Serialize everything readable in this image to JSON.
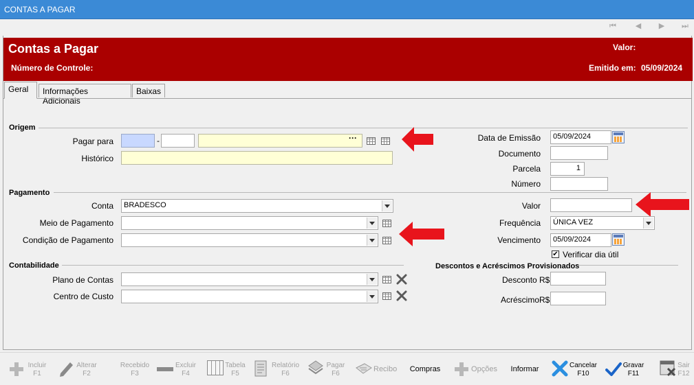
{
  "window": {
    "title": "CONTAS A PAGAR"
  },
  "nav": {
    "first": "⏮",
    "prev": "◀",
    "next": "▶",
    "last": "⏭"
  },
  "header": {
    "title": "Contas a Pagar",
    "valor_label": "Valor:",
    "controle_label": "Número de Controle:",
    "emitido_label": "Emitido em:",
    "emitido_value": "05/09/2024"
  },
  "tabs": [
    "Geral",
    "Informações Adicionais",
    "Baixas"
  ],
  "origem": {
    "section": "Origem",
    "pagar_para_label": "Pagar para",
    "pagar_para_dash": "-",
    "pagar_para_dots": "···",
    "historico_label": "Histórico"
  },
  "right_fields": {
    "data_emissao_label": "Data de Emissão",
    "data_emissao_value": "05/09/2024",
    "documento_label": "Documento",
    "parcela_label": "Parcela",
    "parcela_value": "1",
    "numero_label": "Número",
    "valor_label": "Valor",
    "frequencia_label": "Frequência",
    "frequencia_value": "ÚNICA VEZ",
    "vencimento_label": "Vencimento",
    "vencimento_value": "05/09/2024",
    "verificar_label": "Verificar dia útil",
    "verificar_checked": "✔"
  },
  "pagamento": {
    "section": "Pagamento",
    "conta_label": "Conta",
    "conta_value": "BRADESCO",
    "meio_label": "Meio de Pagamento",
    "condicao_label": "Condição de Pagamento"
  },
  "contabilidade": {
    "section": "Contabilidade",
    "plano_label": "Plano de Contas",
    "centro_label": "Centro de Custo"
  },
  "descontos": {
    "section": "Descontos e Acréscimos  Provisionados",
    "desconto_label": "Desconto",
    "acrescimo_label": "Acréscimo",
    "currency": "R$"
  },
  "toolbar": [
    {
      "name": "incluir",
      "label": "Incluir",
      "key": "F1",
      "enabled": false
    },
    {
      "name": "alterar",
      "label": "Alterar",
      "key": "F2",
      "enabled": false
    },
    {
      "name": "recebido",
      "label": "Recebido",
      "key": "F3",
      "enabled": false
    },
    {
      "name": "excluir",
      "label": "Excluir",
      "key": "F4",
      "enabled": false
    },
    {
      "name": "tabela",
      "label": "Tabela",
      "key": "F5",
      "enabled": false
    },
    {
      "name": "relatorio",
      "label": "Relatório",
      "key": "F6",
      "enabled": false
    },
    {
      "name": "pagar",
      "label": "Pagar",
      "key": "F6",
      "enabled": false
    },
    {
      "name": "recibo",
      "label": "Recibo",
      "key": "",
      "enabled": false
    },
    {
      "name": "compras",
      "label": "Compras",
      "key": "",
      "enabled": true
    },
    {
      "name": "opcoes",
      "label": "Opções",
      "key": "",
      "enabled": false
    },
    {
      "name": "informar",
      "label": "Informar",
      "key": "",
      "enabled": true
    },
    {
      "name": "cancelar",
      "label": "Cancelar",
      "key": "F10",
      "enabled": true
    },
    {
      "name": "gravar",
      "label": "Gravar",
      "key": "F11",
      "enabled": true
    },
    {
      "name": "sair",
      "label": "Sair",
      "key": "F12",
      "enabled": false
    }
  ],
  "colors": {
    "header_red": "#aa0000",
    "titlebar_blue": "#3b8ad6",
    "arrow_red": "#e8141c",
    "field_yellow": "#ffffd6"
  }
}
